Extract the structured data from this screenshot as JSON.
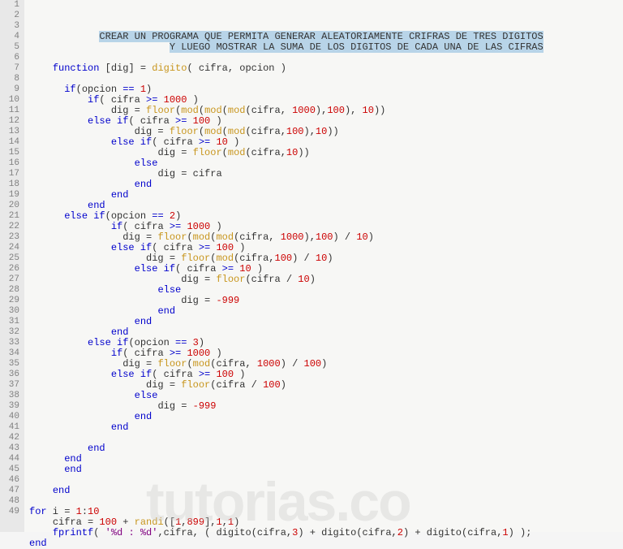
{
  "watermark": "tutorias.co",
  "lines": [
    {
      "n": 1,
      "indent": "            ",
      "sel": true,
      "segs": [
        {
          "t": "CREAR UN PROGRAMA QUE PERMITA GENERAR ALEATORIAMENTE CRIFRAS DE TRES DIGITOS",
          "c": ""
        }
      ]
    },
    {
      "n": 2,
      "indent": "                        ",
      "sel": true,
      "segs": [
        {
          "t": "Y LUEGO MOSTRAR LA SUMA DE LOS DIGITOS DE CADA UNA DE LAS CIFRAS",
          "c": ""
        }
      ]
    },
    {
      "n": 3,
      "indent": "",
      "segs": []
    },
    {
      "n": 4,
      "indent": "    ",
      "segs": [
        {
          "t": "function",
          "c": "kw"
        },
        {
          "t": " [",
          "c": ""
        },
        {
          "t": "dig",
          "c": ""
        },
        {
          "t": "] = ",
          "c": ""
        },
        {
          "t": "digito",
          "c": "fn"
        },
        {
          "t": "( cifra, opcion )",
          "c": ""
        }
      ]
    },
    {
      "n": 5,
      "indent": "",
      "segs": []
    },
    {
      "n": 6,
      "indent": "      ",
      "segs": [
        {
          "t": "if",
          "c": "kw"
        },
        {
          "t": "(opcion ",
          "c": ""
        },
        {
          "t": "==",
          "c": "op"
        },
        {
          "t": " ",
          "c": ""
        },
        {
          "t": "1",
          "c": "num"
        },
        {
          "t": ")",
          "c": ""
        }
      ]
    },
    {
      "n": 7,
      "indent": "          ",
      "segs": [
        {
          "t": "if",
          "c": "kw"
        },
        {
          "t": "( cifra ",
          "c": ""
        },
        {
          "t": ">=",
          "c": "op"
        },
        {
          "t": " ",
          "c": ""
        },
        {
          "t": "1000",
          "c": "num"
        },
        {
          "t": " )",
          "c": ""
        }
      ]
    },
    {
      "n": 8,
      "indent": "              ",
      "segs": [
        {
          "t": "dig = ",
          "c": ""
        },
        {
          "t": "floor",
          "c": "fn"
        },
        {
          "t": "(",
          "c": ""
        },
        {
          "t": "mod",
          "c": "fn"
        },
        {
          "t": "(",
          "c": ""
        },
        {
          "t": "mod",
          "c": "fn"
        },
        {
          "t": "(",
          "c": ""
        },
        {
          "t": "mod",
          "c": "fn"
        },
        {
          "t": "(cifra, ",
          "c": ""
        },
        {
          "t": "1000",
          "c": "num"
        },
        {
          "t": "),",
          "c": ""
        },
        {
          "t": "100",
          "c": "num"
        },
        {
          "t": "), ",
          "c": ""
        },
        {
          "t": "10",
          "c": "num"
        },
        {
          "t": "))",
          "c": ""
        }
      ]
    },
    {
      "n": 9,
      "indent": "          ",
      "segs": [
        {
          "t": "else if",
          "c": "kw"
        },
        {
          "t": "( cifra ",
          "c": ""
        },
        {
          "t": ">=",
          "c": "op"
        },
        {
          "t": " ",
          "c": ""
        },
        {
          "t": "100",
          "c": "num"
        },
        {
          "t": " )",
          "c": ""
        }
      ]
    },
    {
      "n": 10,
      "indent": "                  ",
      "segs": [
        {
          "t": "dig = ",
          "c": ""
        },
        {
          "t": "floor",
          "c": "fn"
        },
        {
          "t": "(",
          "c": ""
        },
        {
          "t": "mod",
          "c": "fn"
        },
        {
          "t": "(",
          "c": ""
        },
        {
          "t": "mod",
          "c": "fn"
        },
        {
          "t": "(cifra,",
          "c": ""
        },
        {
          "t": "100",
          "c": "num"
        },
        {
          "t": "),",
          "c": ""
        },
        {
          "t": "10",
          "c": "num"
        },
        {
          "t": "))",
          "c": ""
        }
      ]
    },
    {
      "n": 11,
      "indent": "              ",
      "segs": [
        {
          "t": "else if",
          "c": "kw"
        },
        {
          "t": "( cifra ",
          "c": ""
        },
        {
          "t": ">=",
          "c": "op"
        },
        {
          "t": " ",
          "c": ""
        },
        {
          "t": "10",
          "c": "num"
        },
        {
          "t": " )",
          "c": ""
        }
      ]
    },
    {
      "n": 12,
      "indent": "                      ",
      "segs": [
        {
          "t": "dig = ",
          "c": ""
        },
        {
          "t": "floor",
          "c": "fn"
        },
        {
          "t": "(",
          "c": ""
        },
        {
          "t": "mod",
          "c": "fn"
        },
        {
          "t": "(cifra,",
          "c": ""
        },
        {
          "t": "10",
          "c": "num"
        },
        {
          "t": "))",
          "c": ""
        }
      ]
    },
    {
      "n": 13,
      "indent": "                  ",
      "segs": [
        {
          "t": "else",
          "c": "kw"
        }
      ]
    },
    {
      "n": 14,
      "indent": "                      ",
      "segs": [
        {
          "t": "dig = cifra",
          "c": ""
        }
      ]
    },
    {
      "n": 15,
      "indent": "                  ",
      "segs": [
        {
          "t": "end",
          "c": "kw"
        }
      ]
    },
    {
      "n": 16,
      "indent": "              ",
      "segs": [
        {
          "t": "end",
          "c": "kw"
        }
      ]
    },
    {
      "n": 17,
      "indent": "          ",
      "segs": [
        {
          "t": "end",
          "c": "kw"
        }
      ]
    },
    {
      "n": 18,
      "indent": "      ",
      "segs": [
        {
          "t": "else if",
          "c": "kw"
        },
        {
          "t": "(opcion ",
          "c": ""
        },
        {
          "t": "==",
          "c": "op"
        },
        {
          "t": " ",
          "c": ""
        },
        {
          "t": "2",
          "c": "num"
        },
        {
          "t": ")",
          "c": ""
        }
      ]
    },
    {
      "n": 19,
      "indent": "              ",
      "segs": [
        {
          "t": "if",
          "c": "kw"
        },
        {
          "t": "( cifra ",
          "c": ""
        },
        {
          "t": ">=",
          "c": "op"
        },
        {
          "t": " ",
          "c": ""
        },
        {
          "t": "1000",
          "c": "num"
        },
        {
          "t": " )",
          "c": ""
        }
      ]
    },
    {
      "n": 20,
      "indent": "                ",
      "segs": [
        {
          "t": "dig = ",
          "c": ""
        },
        {
          "t": "floor",
          "c": "fn"
        },
        {
          "t": "(",
          "c": ""
        },
        {
          "t": "mod",
          "c": "fn"
        },
        {
          "t": "(",
          "c": ""
        },
        {
          "t": "mod",
          "c": "fn"
        },
        {
          "t": "(cifra, ",
          "c": ""
        },
        {
          "t": "1000",
          "c": "num"
        },
        {
          "t": "),",
          "c": ""
        },
        {
          "t": "100",
          "c": "num"
        },
        {
          "t": ") / ",
          "c": ""
        },
        {
          "t": "10",
          "c": "num"
        },
        {
          "t": ")",
          "c": ""
        }
      ]
    },
    {
      "n": 21,
      "indent": "              ",
      "segs": [
        {
          "t": "else if",
          "c": "kw"
        },
        {
          "t": "( cifra ",
          "c": ""
        },
        {
          "t": ">=",
          "c": "op"
        },
        {
          "t": " ",
          "c": ""
        },
        {
          "t": "100",
          "c": "num"
        },
        {
          "t": " )",
          "c": ""
        }
      ]
    },
    {
      "n": 22,
      "indent": "                    ",
      "segs": [
        {
          "t": "dig = ",
          "c": ""
        },
        {
          "t": "floor",
          "c": "fn"
        },
        {
          "t": "(",
          "c": ""
        },
        {
          "t": "mod",
          "c": "fn"
        },
        {
          "t": "(cifra,",
          "c": ""
        },
        {
          "t": "100",
          "c": "num"
        },
        {
          "t": ") / ",
          "c": ""
        },
        {
          "t": "10",
          "c": "num"
        },
        {
          "t": ")",
          "c": ""
        }
      ]
    },
    {
      "n": 23,
      "indent": "                  ",
      "segs": [
        {
          "t": "else if",
          "c": "kw"
        },
        {
          "t": "( cifra ",
          "c": ""
        },
        {
          "t": ">=",
          "c": "op"
        },
        {
          "t": " ",
          "c": ""
        },
        {
          "t": "10",
          "c": "num"
        },
        {
          "t": " )",
          "c": ""
        }
      ]
    },
    {
      "n": 24,
      "indent": "                          ",
      "segs": [
        {
          "t": "dig = ",
          "c": ""
        },
        {
          "t": "floor",
          "c": "fn"
        },
        {
          "t": "(cifra / ",
          "c": ""
        },
        {
          "t": "10",
          "c": "num"
        },
        {
          "t": ")",
          "c": ""
        }
      ]
    },
    {
      "n": 25,
      "indent": "                      ",
      "segs": [
        {
          "t": "else",
          "c": "kw"
        }
      ]
    },
    {
      "n": 26,
      "indent": "                          ",
      "segs": [
        {
          "t": "dig = ",
          "c": ""
        },
        {
          "t": "-999",
          "c": "num"
        }
      ]
    },
    {
      "n": 27,
      "indent": "                      ",
      "segs": [
        {
          "t": "end",
          "c": "kw"
        }
      ]
    },
    {
      "n": 28,
      "indent": "                  ",
      "segs": [
        {
          "t": "end",
          "c": "kw"
        }
      ]
    },
    {
      "n": 29,
      "indent": "              ",
      "segs": [
        {
          "t": "end",
          "c": "kw"
        }
      ]
    },
    {
      "n": 30,
      "indent": "          ",
      "segs": [
        {
          "t": "else if",
          "c": "kw"
        },
        {
          "t": "(opcion ",
          "c": ""
        },
        {
          "t": "==",
          "c": "op"
        },
        {
          "t": " ",
          "c": ""
        },
        {
          "t": "3",
          "c": "num"
        },
        {
          "t": ")",
          "c": ""
        }
      ]
    },
    {
      "n": 31,
      "indent": "              ",
      "segs": [
        {
          "t": "if",
          "c": "kw"
        },
        {
          "t": "( cifra ",
          "c": ""
        },
        {
          "t": ">=",
          "c": "op"
        },
        {
          "t": " ",
          "c": ""
        },
        {
          "t": "1000",
          "c": "num"
        },
        {
          "t": " )",
          "c": ""
        }
      ]
    },
    {
      "n": 32,
      "indent": "                ",
      "segs": [
        {
          "t": "dig = ",
          "c": ""
        },
        {
          "t": "floor",
          "c": "fn"
        },
        {
          "t": "(",
          "c": ""
        },
        {
          "t": "mod",
          "c": "fn"
        },
        {
          "t": "(cifra, ",
          "c": ""
        },
        {
          "t": "1000",
          "c": "num"
        },
        {
          "t": ") / ",
          "c": ""
        },
        {
          "t": "100",
          "c": "num"
        },
        {
          "t": ")",
          "c": ""
        }
      ]
    },
    {
      "n": 33,
      "indent": "              ",
      "segs": [
        {
          "t": "else if",
          "c": "kw"
        },
        {
          "t": "( cifra ",
          "c": ""
        },
        {
          "t": ">=",
          "c": "op"
        },
        {
          "t": " ",
          "c": ""
        },
        {
          "t": "100",
          "c": "num"
        },
        {
          "t": " )",
          "c": ""
        }
      ]
    },
    {
      "n": 34,
      "indent": "                    ",
      "segs": [
        {
          "t": "dig = ",
          "c": ""
        },
        {
          "t": "floor",
          "c": "fn"
        },
        {
          "t": "(cifra / ",
          "c": ""
        },
        {
          "t": "100",
          "c": "num"
        },
        {
          "t": ")",
          "c": ""
        }
      ]
    },
    {
      "n": 35,
      "indent": "                  ",
      "segs": [
        {
          "t": "else",
          "c": "kw"
        }
      ]
    },
    {
      "n": 36,
      "indent": "                      ",
      "segs": [
        {
          "t": "dig = ",
          "c": ""
        },
        {
          "t": "-999",
          "c": "num"
        }
      ]
    },
    {
      "n": 37,
      "indent": "                  ",
      "segs": [
        {
          "t": "end",
          "c": "kw"
        }
      ]
    },
    {
      "n": 38,
      "indent": "              ",
      "segs": [
        {
          "t": "end",
          "c": "kw"
        }
      ]
    },
    {
      "n": 39,
      "indent": "",
      "segs": []
    },
    {
      "n": 40,
      "indent": "          ",
      "segs": [
        {
          "t": "end",
          "c": "kw"
        }
      ]
    },
    {
      "n": 41,
      "indent": "      ",
      "segs": [
        {
          "t": "end",
          "c": "kw"
        }
      ]
    },
    {
      "n": 42,
      "indent": "      ",
      "segs": [
        {
          "t": "end",
          "c": "kw"
        }
      ]
    },
    {
      "n": 43,
      "indent": "",
      "segs": []
    },
    {
      "n": 44,
      "indent": "    ",
      "segs": [
        {
          "t": "end",
          "c": "kw"
        }
      ]
    },
    {
      "n": 45,
      "indent": "",
      "segs": []
    },
    {
      "n": 46,
      "indent": "",
      "segs": [
        {
          "t": "for",
          "c": "kw"
        },
        {
          "t": " i = ",
          "c": ""
        },
        {
          "t": "1",
          "c": "num"
        },
        {
          "t": ":",
          "c": ""
        },
        {
          "t": "10",
          "c": "num"
        }
      ]
    },
    {
      "n": 47,
      "indent": "    ",
      "segs": [
        {
          "t": "cifra = ",
          "c": ""
        },
        {
          "t": "100",
          "c": "num"
        },
        {
          "t": " + ",
          "c": ""
        },
        {
          "t": "randi",
          "c": "fn"
        },
        {
          "t": "([",
          "c": ""
        },
        {
          "t": "1",
          "c": "num"
        },
        {
          "t": ",",
          "c": ""
        },
        {
          "t": "899",
          "c": "num"
        },
        {
          "t": "],",
          "c": ""
        },
        {
          "t": "1",
          "c": "num"
        },
        {
          "t": ",",
          "c": ""
        },
        {
          "t": "1",
          "c": "num"
        },
        {
          "t": ")",
          "c": ""
        }
      ]
    },
    {
      "n": 48,
      "indent": "    ",
      "segs": [
        {
          "t": "fprintf",
          "c": "kw"
        },
        {
          "t": "( ",
          "c": ""
        },
        {
          "t": "'%d : %d'",
          "c": "str"
        },
        {
          "t": ",cifra, ( ",
          "c": ""
        },
        {
          "t": "digito",
          "c": ""
        },
        {
          "t": "(cifra,",
          "c": ""
        },
        {
          "t": "3",
          "c": "num"
        },
        {
          "t": ") + ",
          "c": ""
        },
        {
          "t": "digito",
          "c": ""
        },
        {
          "t": "(cifra,",
          "c": ""
        },
        {
          "t": "2",
          "c": "num"
        },
        {
          "t": ") + ",
          "c": ""
        },
        {
          "t": "digito",
          "c": ""
        },
        {
          "t": "(cifra,",
          "c": ""
        },
        {
          "t": "1",
          "c": "num"
        },
        {
          "t": ") );",
          "c": ""
        }
      ]
    },
    {
      "n": 49,
      "indent": "",
      "segs": [
        {
          "t": "end",
          "c": "kw"
        }
      ]
    }
  ]
}
